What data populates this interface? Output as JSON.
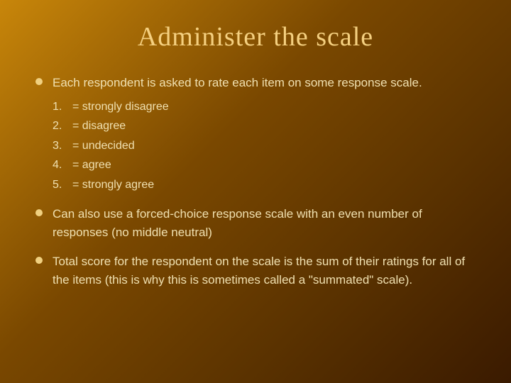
{
  "slide": {
    "title": "Administer the scale",
    "bullets": [
      {
        "id": "bullet-1",
        "text": "Each respondent is asked to rate each item on some response scale.",
        "sublist": [
          {
            "num": "1.",
            "text": "= strongly disagree"
          },
          {
            "num": "2.",
            "text": "= disagree"
          },
          {
            "num": "3.",
            "text": "= undecided"
          },
          {
            "num": "4.",
            "text": "= agree"
          },
          {
            "num": "5.",
            "text": "= strongly agree"
          }
        ]
      },
      {
        "id": "bullet-2",
        "text": "Can also use a forced-choice response scale with an even number of responses (no middle neutral)",
        "sublist": []
      },
      {
        "id": "bullet-3",
        "text": "Total score for the respondent on the scale is the sum of their ratings for all of the items (this is why this is sometimes called a \"summated\" scale).",
        "sublist": []
      }
    ]
  }
}
